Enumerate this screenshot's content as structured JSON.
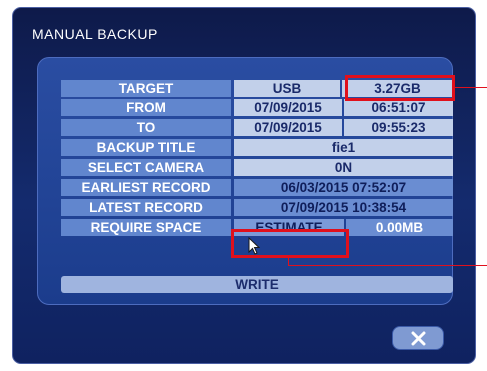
{
  "dialog": {
    "title": "MANUAL BACKUP",
    "write_label": "WRITE",
    "close_icon": "close-x-icon"
  },
  "rows": {
    "target": {
      "label": "TARGET",
      "device": "USB",
      "capacity": "3.27GB"
    },
    "from": {
      "label": "FROM",
      "date": "07/09/2015",
      "time": "06:51:07"
    },
    "to": {
      "label": "TO",
      "date": "07/09/2015",
      "time": "09:55:23"
    },
    "title": {
      "label": "BACKUP TITLE",
      "value": "fie1"
    },
    "camera": {
      "label": "SELECT CAMERA",
      "value": "0N"
    },
    "earliest": {
      "label": "EARLIEST RECORD",
      "value": "06/03/2015 07:52:07"
    },
    "latest": {
      "label": "LATEST RECORD",
      "value": "07/09/2015 10:38:54"
    },
    "space": {
      "label": "REQUIRE SPACE",
      "estimate_label": "ESTIMATE",
      "size": "0.00MB"
    }
  },
  "colors": {
    "highlight": "#e0101c",
    "label_cell": "#6186ce",
    "value_cell": "#c2d0ea"
  }
}
